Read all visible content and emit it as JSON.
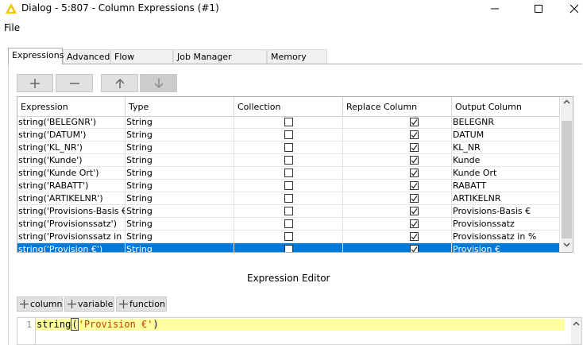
{
  "window": {
    "title": "Dialog - 5:807 - Column Expressions (#1)",
    "icons": [
      "knime-logo-icon",
      "minimize-icon",
      "maximize-icon",
      "close-icon"
    ]
  },
  "menu": {
    "file": "File"
  },
  "tabs": [
    {
      "label": "Expressions",
      "active": true
    },
    {
      "label": "Advanced"
    },
    {
      "label": "Flow Variables"
    },
    {
      "label": "Job Manager Selection"
    },
    {
      "label": "Memory Policy"
    }
  ],
  "toolbar": {
    "icons": [
      "plus-icon",
      "minus-icon",
      "arrow-up-icon",
      "arrow-down-icon"
    ]
  },
  "table": {
    "headers": [
      "Expression",
      "Type",
      "Collection",
      "Replace Column",
      "Output Column"
    ],
    "rows": [
      {
        "expression": "string('BELEGNR')",
        "type": "String",
        "collection": false,
        "replace": true,
        "output": "BELEGNR"
      },
      {
        "expression": "string('DATUM')",
        "type": "String",
        "collection": false,
        "replace": true,
        "output": "DATUM"
      },
      {
        "expression": "string('KL_NR')",
        "type": "String",
        "collection": false,
        "replace": true,
        "output": "KL_NR"
      },
      {
        "expression": "string('Kunde')",
        "type": "String",
        "collection": false,
        "replace": true,
        "output": "Kunde"
      },
      {
        "expression": "string('Kunde Ort')",
        "type": "String",
        "collection": false,
        "replace": true,
        "output": "Kunde Ort"
      },
      {
        "expression": "string('RABATT')",
        "type": "String",
        "collection": false,
        "replace": true,
        "output": "RABATT"
      },
      {
        "expression": "string('ARTIKELNR')",
        "type": "String",
        "collection": false,
        "replace": true,
        "output": "ARTIKELNR"
      },
      {
        "expression": "string('Provisions-Basis €')",
        "type": "String",
        "collection": false,
        "replace": true,
        "output": "Provisions-Basis €"
      },
      {
        "expression": "string('Provisionssatz')",
        "type": "String",
        "collection": false,
        "replace": true,
        "output": "Provisionssatz"
      },
      {
        "expression": "string('Provisionssatz in %')",
        "type": "String",
        "collection": false,
        "replace": true,
        "output": "Provisionssatz in %"
      },
      {
        "expression": "string('Provision €')",
        "type": "String",
        "collection": false,
        "replace": true,
        "output": "Provision €",
        "selected": true
      }
    ]
  },
  "editor": {
    "title": "Expression Editor",
    "buttons": [
      "column",
      "variable",
      "function"
    ],
    "line_number": "1",
    "code_func": "string",
    "code_open": "(",
    "code_arg": "'Provision €'",
    "code_close": ")"
  },
  "colors": {
    "selection": "#0078d7",
    "code_highlight": "#ffffa0",
    "logo": "#f5c400"
  }
}
